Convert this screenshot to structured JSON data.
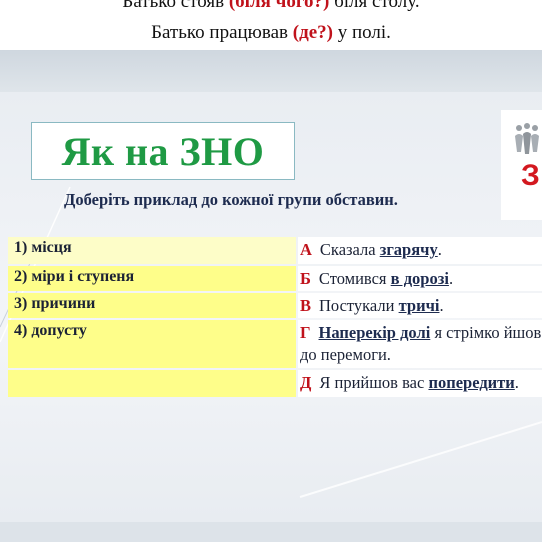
{
  "top": {
    "line1_pre": "Батько стояв ",
    "line1_q": "(біля чого?)",
    "line1_post": " біля столу.",
    "line2_pre": "Батько працював ",
    "line2_q": "(де?)",
    "line2_post": " у полі."
  },
  "title": "Як на ЗНО",
  "logo_text": "З",
  "subtitle": "Доберіть приклад до кожної групи обставин.",
  "left_items": [
    "1) місця",
    "2) міри і ступеня",
    "3) причини",
    "4) допусту",
    ""
  ],
  "options": [
    {
      "letter": "А",
      "pre": "Сказала ",
      "word": "згарячу",
      "post": "."
    },
    {
      "letter": "Б",
      "pre": "Стомився ",
      "word": "в дорозі",
      "post": "."
    },
    {
      "letter": "В",
      "pre": "Постукали ",
      "word": "тричі",
      "post": "."
    },
    {
      "letter": "Г",
      "pre": "",
      "word": "Наперекір долі",
      "post": " я стрімко йшов до перемоги."
    },
    {
      "letter": "Д",
      "pre": "Я прийшов вас ",
      "word": "попередити",
      "post": "."
    }
  ],
  "colors": {
    "title_green": "#1f9a44",
    "accent_red": "#c0121b",
    "cell_yellow": "#fefe8a"
  }
}
